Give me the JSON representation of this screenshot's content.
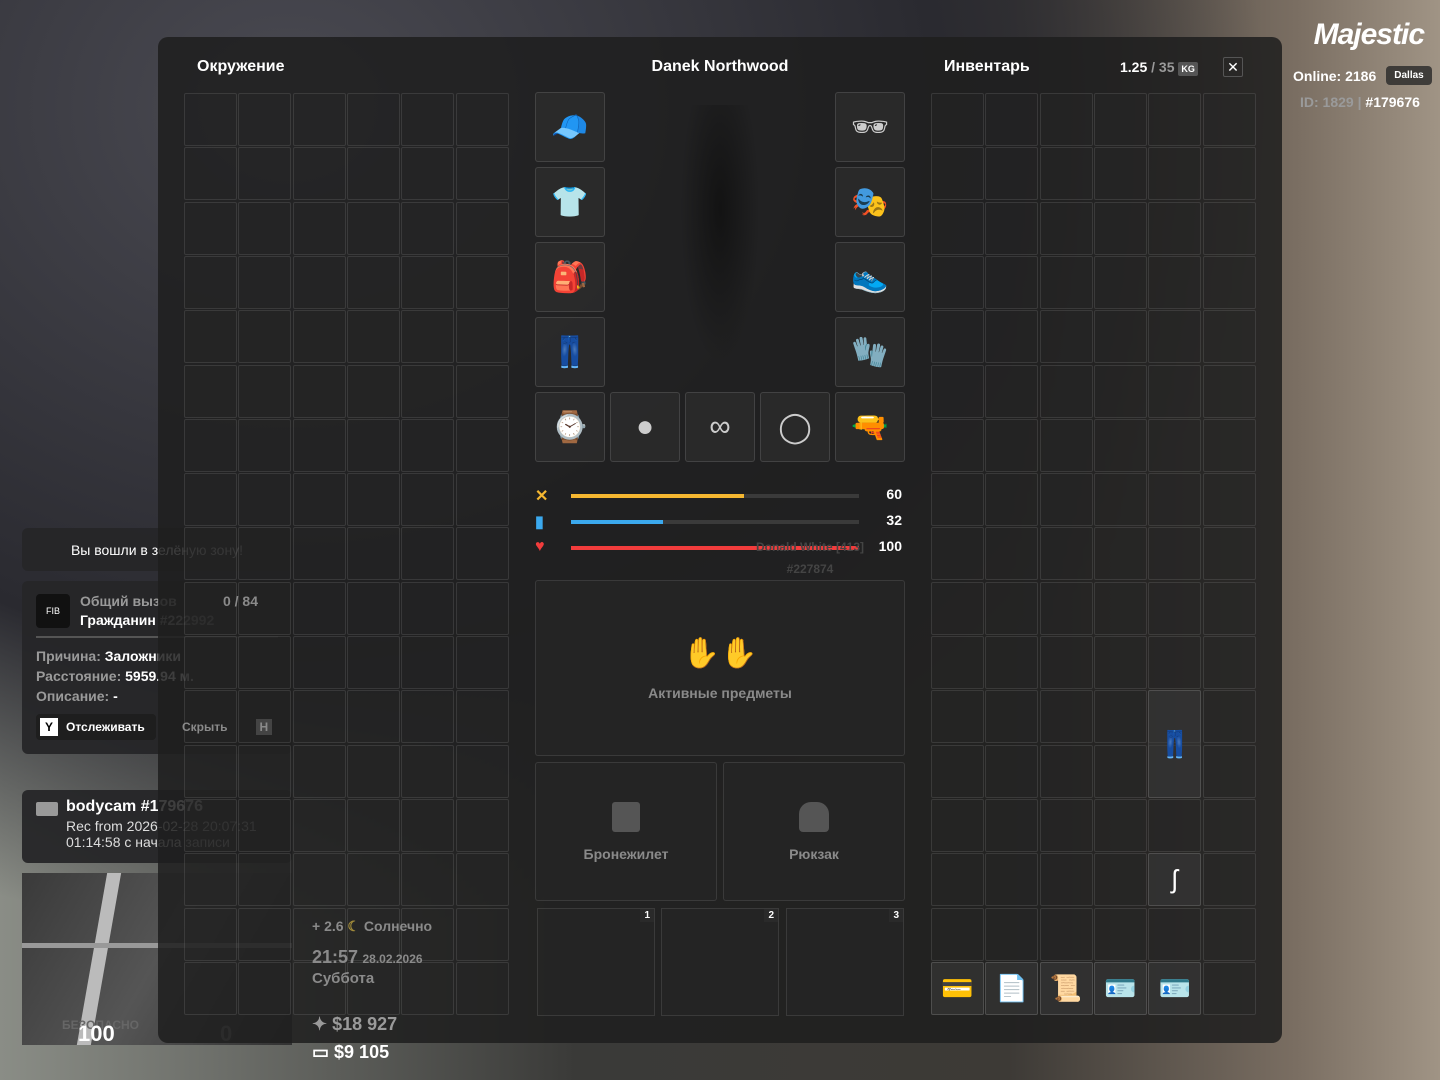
{
  "brand": {
    "logo": "Majestic",
    "online_label": "Online: 2186",
    "server": "Dallas",
    "id_label": "ID: 1829 |",
    "id_hash": "#179676"
  },
  "hud": {
    "zone_msg": "Вы вошли в зелёную зону!",
    "call": {
      "title": "Общий вызов",
      "count": "0 / 84",
      "citizen": "Гражданин",
      "citizen_id": "#222992",
      "reason_label": "Причина:",
      "reason": "Заложники",
      "distance_label": "Расстояние:",
      "distance": "5959.94 м.",
      "desc_label": "Описание:",
      "desc": "-",
      "track_key": "Y",
      "track_label": "Отслеживать",
      "hide_label": "Скрыть",
      "hide_key": "H",
      "badge": "FIB"
    },
    "bodycam": {
      "title": "bodycam #179676",
      "rec": "Rec from 2026-02-28 20:07:31",
      "elapsed": "01:14:58 с начала записи"
    },
    "map": {
      "health": "100",
      "armor": "0",
      "safe": "БЕЗОПАСНО"
    },
    "weather": {
      "temp": "+ 2.6",
      "condition": "Солнечно",
      "time": "21:57",
      "date": "28.02.2026",
      "day": "Суббота"
    },
    "cash": "$18 927",
    "bank": "$9 105"
  },
  "panel": {
    "env_title": "Окружение",
    "char_name": "Danek Northwood",
    "inv_title": "Инвентарь",
    "weight": "1.25",
    "weight_max": "/ 35",
    "unit": "KG",
    "stats": [
      {
        "icon": "food-icon",
        "value": "60",
        "pct": 60,
        "color": "#f5b731"
      },
      {
        "icon": "water-icon",
        "value": "32",
        "pct": 32,
        "color": "#3ba9ee"
      },
      {
        "icon": "health-icon",
        "value": "100",
        "pct": 100,
        "color": "#f23c3c"
      }
    ],
    "nearby_name": "Donald White [413]",
    "nearby_id": "#227874",
    "active_label": "Активные предметы",
    "armor_label": "Бронежилет",
    "backpack_label": "Рюкзак",
    "quickslots": [
      "1",
      "2",
      "3"
    ],
    "equipment": [
      {
        "name": "cap",
        "glyph": "🧢"
      },
      {
        "name": "shirt",
        "glyph": "👕"
      },
      {
        "name": "bag",
        "glyph": "🎒"
      },
      {
        "name": "pants",
        "glyph": "👖"
      },
      {
        "name": "glasses",
        "glyph": "🕶"
      },
      {
        "name": "mask",
        "glyph": "🎭"
      },
      {
        "name": "shoes",
        "glyph": "👟"
      },
      {
        "name": "gloves",
        "glyph": "🧤"
      },
      {
        "name": "watch",
        "glyph": "⌚"
      },
      {
        "name": "balaclava",
        "glyph": "●"
      },
      {
        "name": "earrings",
        "glyph": "∞"
      },
      {
        "name": "bracelet",
        "glyph": "◯"
      },
      {
        "name": "holster",
        "glyph": "🔫"
      }
    ],
    "inventory_items": [
      {
        "name": "jeans",
        "glyph": "👖",
        "col": 4,
        "row": 11,
        "span": 2
      },
      {
        "name": "earphone",
        "glyph": "ʃ",
        "col": 4,
        "row": 14,
        "span": 1
      },
      {
        "name": "green-card",
        "glyph": "💳",
        "col": 0,
        "row": 16,
        "span": 1
      },
      {
        "name": "document-1",
        "glyph": "📄",
        "col": 1,
        "row": 16,
        "span": 1
      },
      {
        "name": "certificate",
        "glyph": "📜",
        "col": 2,
        "row": 16,
        "span": 1
      },
      {
        "name": "id-card-1",
        "glyph": "🪪",
        "col": 3,
        "row": 16,
        "span": 1
      },
      {
        "name": "id-card-2",
        "glyph": "🪪",
        "col": 4,
        "row": 16,
        "span": 1
      }
    ]
  }
}
